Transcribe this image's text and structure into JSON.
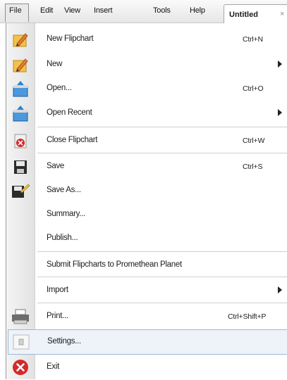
{
  "menubar": {
    "file": "File",
    "edit": "Edit",
    "view": "View",
    "insert": "Insert",
    "tools": "Tools",
    "help": "Help",
    "doc_tab": "Untitled",
    "doc_tab_close": "×"
  },
  "file_menu": {
    "new_flipchart": {
      "label": "New Flipchart",
      "shortcut": "Ctrl+N",
      "icon": "pencil-icon"
    },
    "new": {
      "label": "New",
      "icon": "pencil-icon",
      "submenu": true
    },
    "open": {
      "label": "Open...",
      "shortcut": "Ctrl+O",
      "icon": "open-flipchart-icon"
    },
    "open_recent": {
      "label": "Open Recent",
      "icon": "open-recent-icon",
      "submenu": true
    },
    "close_flipchart": {
      "label": "Close Flipchart",
      "shortcut": "Ctrl+W",
      "icon": "close-flipchart-icon"
    },
    "save": {
      "label": "Save",
      "shortcut": "Ctrl+S",
      "icon": "floppy-disk-icon"
    },
    "save_as": {
      "label": "Save As...",
      "icon": "save-as-icon"
    },
    "summary": {
      "label": "Summary..."
    },
    "publish": {
      "label": "Publish..."
    },
    "submit": {
      "label": "Submit Flipcharts to Promethean Planet"
    },
    "import": {
      "label": "Import",
      "submenu": true
    },
    "print": {
      "label": "Print...",
      "shortcut": "Ctrl+Shift+P",
      "icon": "printer-icon"
    },
    "settings": {
      "label": "Settings...",
      "icon": "settings-icon",
      "highlighted": true
    },
    "exit": {
      "label": "Exit",
      "icon": "exit-icon"
    }
  },
  "colors": {
    "highlight_border": "#9fb6d6",
    "highlight_fill": "#eef3fa",
    "exit_red": "#d42a2a",
    "icon_blue": "#2a83d6"
  }
}
